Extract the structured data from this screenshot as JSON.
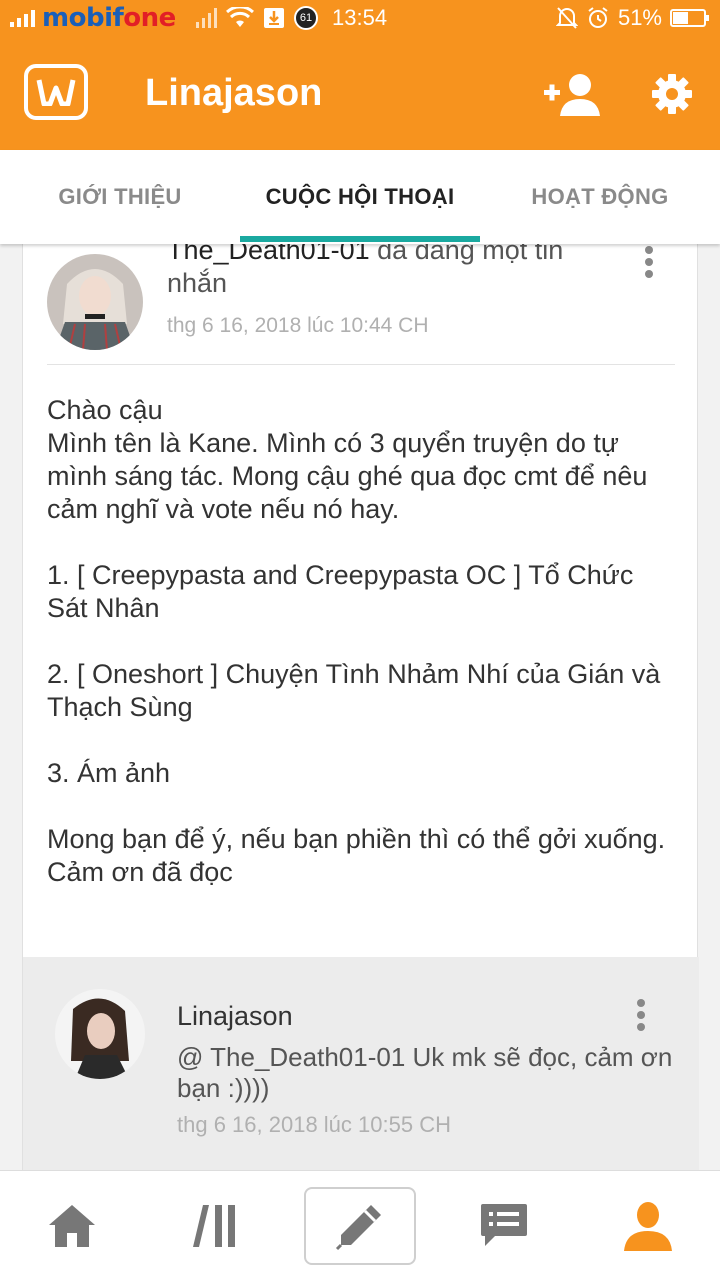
{
  "status_bar": {
    "carrier_brand": "mobif",
    "carrier_rest": "one",
    "notification_count": "61",
    "time": "13:54",
    "battery": "51%",
    "battery_level": 0.51
  },
  "app_bar": {
    "title": "Linajason"
  },
  "tabs": [
    {
      "label": "GIỚI THIỆU",
      "active": false
    },
    {
      "label": "CUỘC HỘI THOẠI",
      "active": true
    },
    {
      "label": "HOẠT ĐỘNG",
      "active": false
    }
  ],
  "post": {
    "author": "The_Death01-01",
    "action": " đã đăng một tin nhắn",
    "timestamp": "thg 6 16, 2018 lúc 10:44 CH",
    "message": "Chào cậu\nMình tên là Kane. Mình có 3 quyển truyện do tự mình sáng tác. Mong cậu ghé qua đọc cmt để nêu cảm nghĩ và vote nếu nó hay.\n\n1. [ Creepypasta and Creepypasta OC ] Tổ Chức Sát Nhân\n\n2. [ Oneshort ] Chuyện Tình Nhảm Nhí của Gián và Thạch Sùng\n\n3. Ám ảnh\n\nMong bạn để ý, nếu bạn phiền thì có thể gởi xuống.\nCảm ơn đã đọc"
  },
  "reply": {
    "author": "Linajason",
    "text": "@ The_Death01-01  Uk mk sẽ đọc, cảm ơn bạn :))))",
    "timestamp": "thg 6 16, 2018 lúc 10:55 CH"
  },
  "colors": {
    "brand_orange": "#f7931e",
    "tab_indicator": "#1aa9a0",
    "profile_active": "#f7931e"
  },
  "bottom_nav": [
    "home-icon",
    "library-icon",
    "write-icon",
    "messages-icon",
    "profile-icon"
  ]
}
